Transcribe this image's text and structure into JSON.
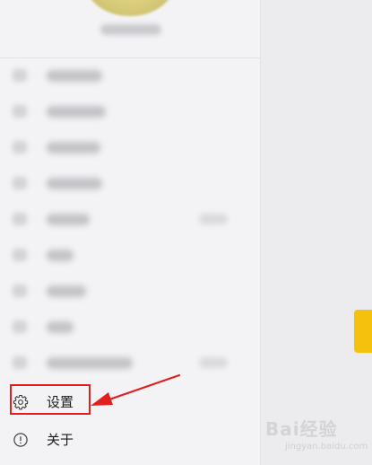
{
  "sidebar": {
    "settings_label": "设置",
    "about_label": "关于"
  },
  "watermark": {
    "logo_text": "Bai经验",
    "url": "jingyan.baidu.com"
  },
  "colors": {
    "highlight": "#e0201e",
    "accent_yellow": "#f4c20d"
  }
}
